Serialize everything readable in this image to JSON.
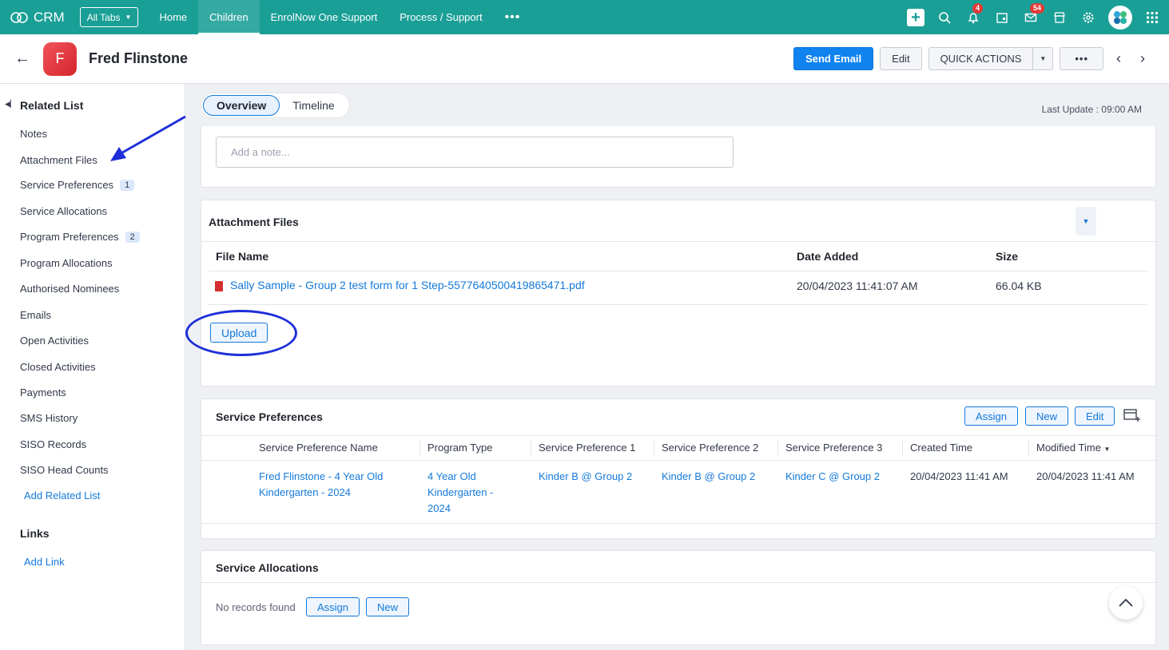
{
  "app": {
    "name": "CRM",
    "all_tabs": "All Tabs"
  },
  "nav": {
    "links": [
      "Home",
      "Children",
      "EnrolNow One Support",
      "Process / Support"
    ],
    "active": "Children",
    "more": "•••"
  },
  "top_icons": {
    "notifications_badge": "4",
    "mail_badge": "54"
  },
  "record": {
    "initial": "F",
    "name": "Fred Flinstone"
  },
  "header_actions": {
    "send_email": "Send Email",
    "edit": "Edit",
    "quick_actions": "QUICK ACTIONS",
    "more": "•••"
  },
  "sidebar": {
    "title": "Related List",
    "items": [
      {
        "label": "Notes",
        "count": ""
      },
      {
        "label": "Attachment Files",
        "count": ""
      },
      {
        "label": "Service Preferences",
        "count": "1"
      },
      {
        "label": "Service Allocations",
        "count": ""
      },
      {
        "label": "Program Preferences",
        "count": "2"
      },
      {
        "label": "Program Allocations",
        "count": ""
      },
      {
        "label": "Authorised Nominees",
        "count": ""
      },
      {
        "label": "Emails",
        "count": ""
      },
      {
        "label": "Open Activities",
        "count": ""
      },
      {
        "label": "Closed Activities",
        "count": ""
      },
      {
        "label": "Payments",
        "count": ""
      },
      {
        "label": "SMS History",
        "count": ""
      },
      {
        "label": "SISO Records",
        "count": ""
      },
      {
        "label": "SISO Head Counts",
        "count": ""
      }
    ],
    "add_related_list": "Add Related List",
    "links_title": "Links",
    "add_link": "Add Link"
  },
  "tabs": {
    "overview": "Overview",
    "timeline": "Timeline"
  },
  "last_update": "Last Update : 09:00 AM",
  "notes": {
    "placeholder": "Add a note..."
  },
  "attachments": {
    "title": "Attachment Files",
    "columns": [
      "File Name",
      "Date Added",
      "Size"
    ],
    "rows": [
      {
        "file": "Sally Sample -  Group 2 test form for 1 Step-5577640500419865471.pdf",
        "date": "20/04/2023 11:41:07 AM",
        "size": "66.04 KB"
      }
    ],
    "upload": "Upload"
  },
  "service_preferences": {
    "title": "Service Preferences",
    "buttons": {
      "assign": "Assign",
      "new": "New",
      "edit": "Edit"
    },
    "columns": [
      "Service Preference Name",
      "Program Type",
      "Service Preference 1",
      "Service Preference 2",
      "Service Preference 3",
      "Created Time",
      "Modified Time"
    ],
    "row": {
      "name_1": "Fred Flinstone - 4 Year Old",
      "name_2": "Kindergarten - 2024",
      "program_1": "4 Year Old",
      "program_2": "Kindergarten -",
      "program_3": "2024",
      "pref1": "Kinder B @ Group 2",
      "pref2": "Kinder B @ Group 2",
      "pref3": "Kinder C @ Group 2",
      "created": "20/04/2023 11:41 AM",
      "modified": "20/04/2023 11:41 AM"
    }
  },
  "service_allocations": {
    "title": "Service Allocations",
    "no_records": "No records found",
    "assign": "Assign",
    "new": "New"
  }
}
